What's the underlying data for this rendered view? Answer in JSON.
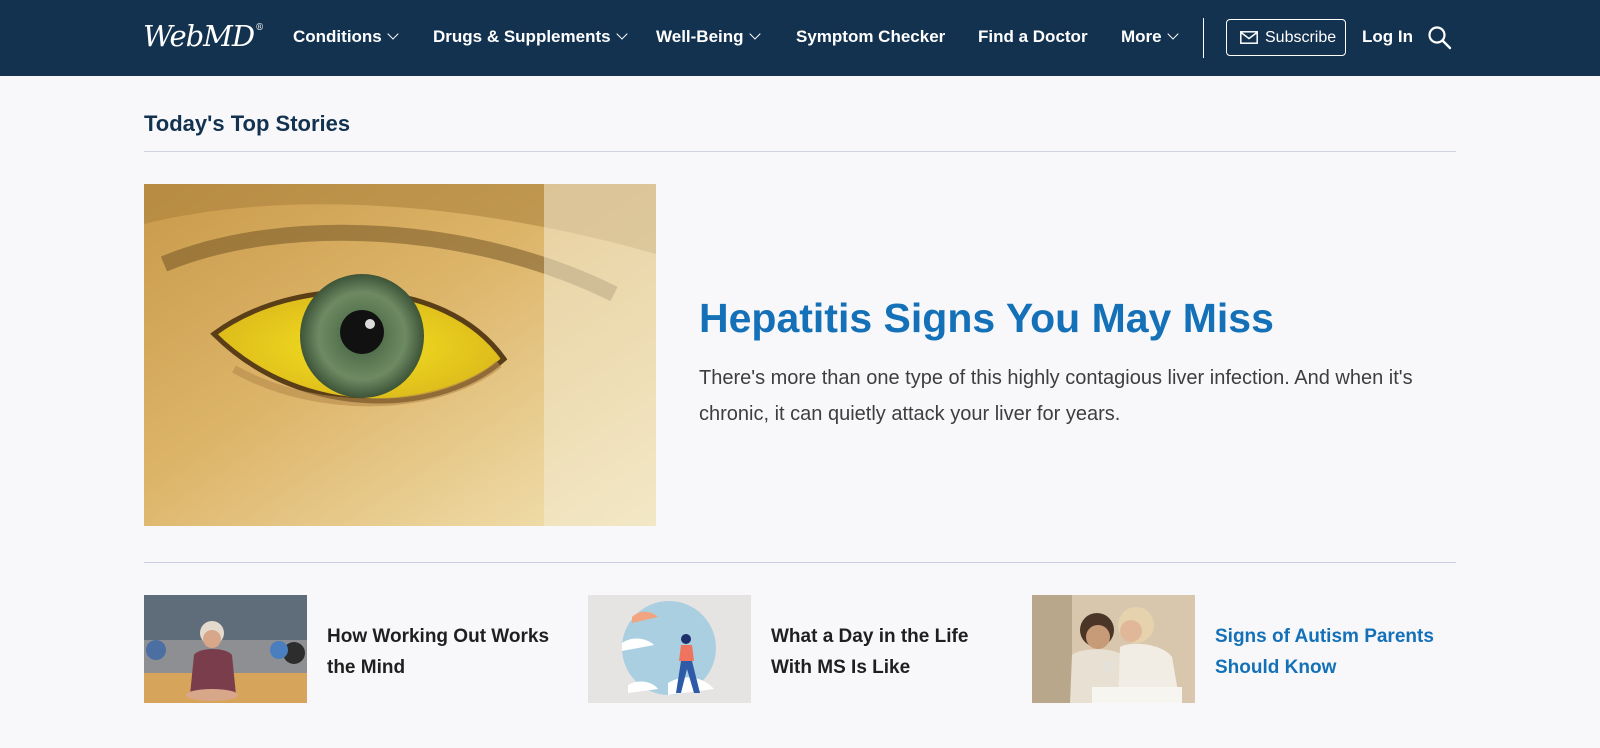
{
  "nav": {
    "logo": "WebMD",
    "logo_mark": "®",
    "items": [
      {
        "label": "Conditions",
        "dropdown": true
      },
      {
        "label": "Drugs & Supplements",
        "dropdown": true
      },
      {
        "label": "Well-Being",
        "dropdown": true
      },
      {
        "label": "Symptom Checker",
        "dropdown": false
      },
      {
        "label": "Find a Doctor",
        "dropdown": false
      },
      {
        "label": "More",
        "dropdown": true
      }
    ],
    "subscribe_label": "Subscribe",
    "login_label": "Log In",
    "icons": {
      "subscribe": "mail-icon",
      "search": "search-icon",
      "dropdown": "chevron-down-icon"
    }
  },
  "section": {
    "title": "Today's Top Stories"
  },
  "hero": {
    "title": "Hepatitis Signs You May Miss",
    "description": "There's more than one type of this highly contagious liver infection. And when it's chronic, it can quietly attack your liver for years.",
    "image": "close-up of a yellow jaundiced eye"
  },
  "stories": [
    {
      "title": "How Working Out Works the Mind",
      "image": "woman doing plank exercise in gym class"
    },
    {
      "title": "What a Day in the Life With MS Is Like",
      "image": "illustration of woman walking in clouds"
    },
    {
      "title": "Signs of Autism Parents Should Know",
      "image": "mother and child looking at a toy",
      "highlighted": true
    }
  ],
  "colors": {
    "nav_bg": "#13324f",
    "link": "#1471b8",
    "page_bg": "#f8f8fb",
    "heading": "#13324f"
  }
}
